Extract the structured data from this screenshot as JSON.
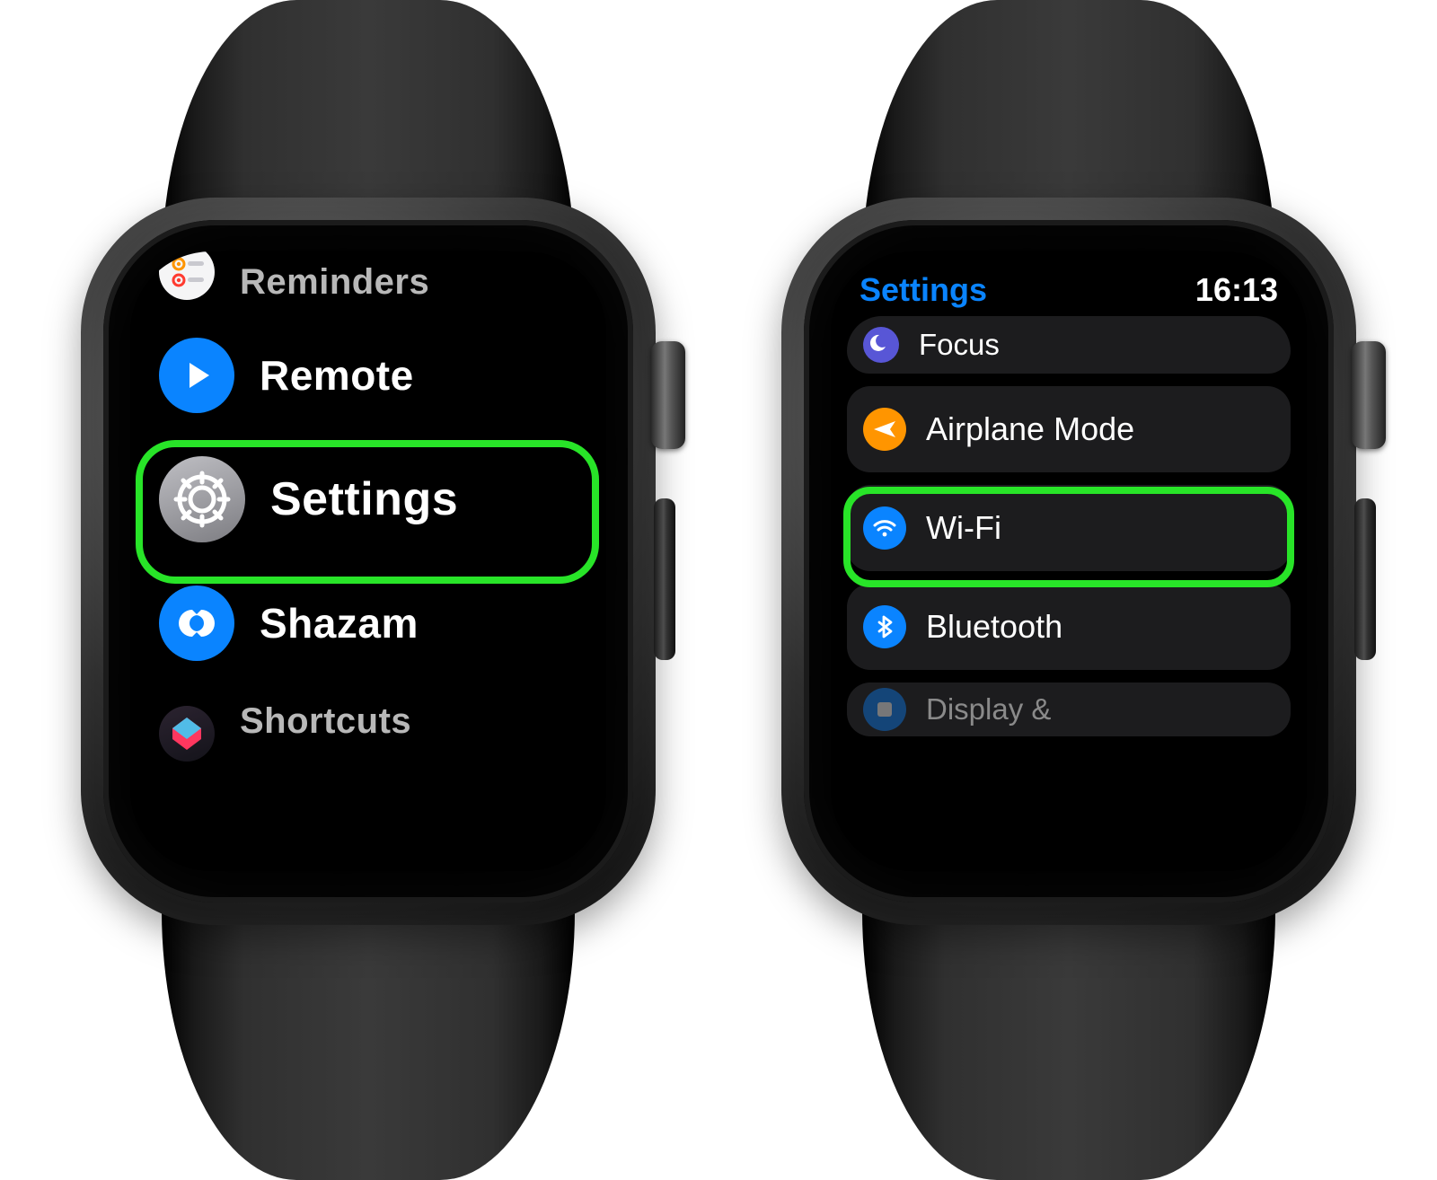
{
  "left_watch": {
    "apps": [
      {
        "id": "reminders",
        "label": "Reminders",
        "icon": "reminders-icon",
        "bg": "bg-white"
      },
      {
        "id": "remote",
        "label": "Remote",
        "icon": "play-icon",
        "bg": "bg-blue"
      },
      {
        "id": "settings",
        "label": "Settings",
        "icon": "gear-icon",
        "bg": "bg-grey",
        "highlight": true
      },
      {
        "id": "shazam",
        "label": "Shazam",
        "icon": "shazam-icon",
        "bg": "bg-blue"
      },
      {
        "id": "shortcuts",
        "label": "Shortcuts",
        "icon": "shortcuts-icon",
        "bg": "bg-dark"
      }
    ]
  },
  "right_watch": {
    "header": {
      "title": "Settings",
      "time": "16:13"
    },
    "rows": [
      {
        "id": "focus",
        "label": "Focus",
        "icon": "moon-icon",
        "bg": "bg-purple"
      },
      {
        "id": "airplane",
        "label": "Airplane Mode",
        "icon": "airplane-icon",
        "bg": "bg-orange"
      },
      {
        "id": "wifi",
        "label": "Wi-Fi",
        "icon": "wifi-icon",
        "bg": "bg-blue",
        "highlight": true
      },
      {
        "id": "bluetooth",
        "label": "Bluetooth",
        "icon": "bluetooth-icon",
        "bg": "bg-blue"
      },
      {
        "id": "display",
        "label": "Display &",
        "icon": "display-icon",
        "bg": "bg-blue"
      }
    ]
  },
  "colors": {
    "highlight": "#28e428"
  }
}
